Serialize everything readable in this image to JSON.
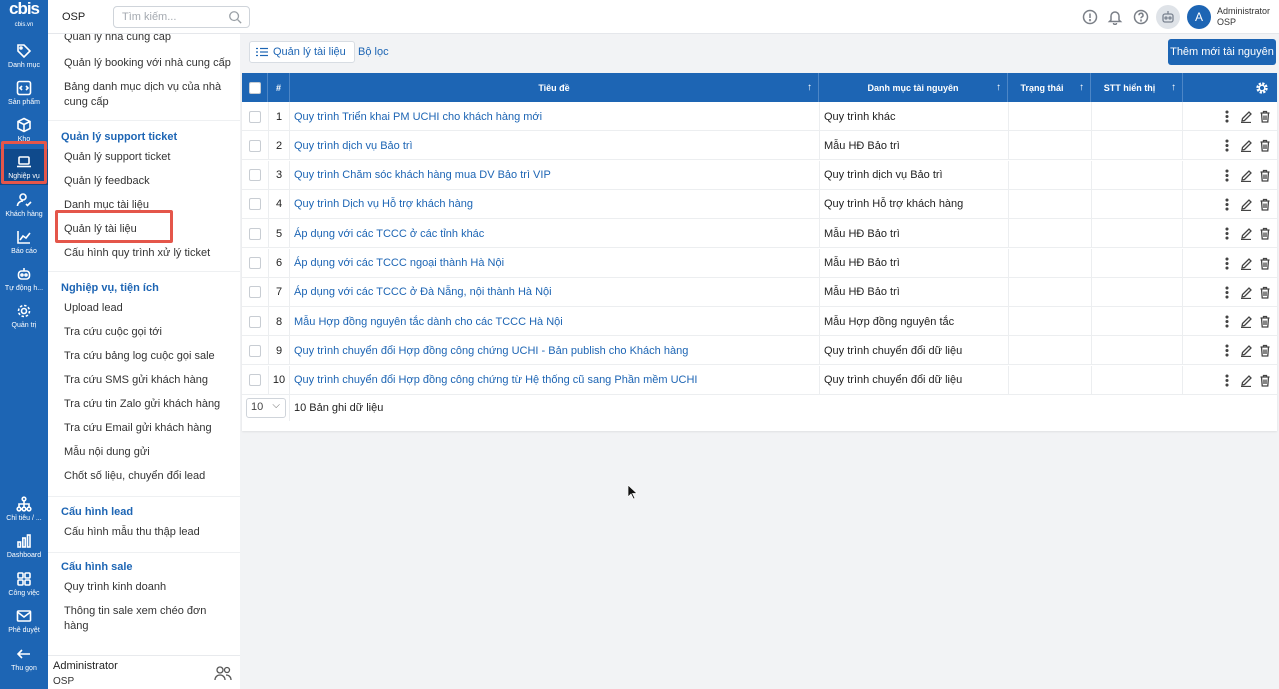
{
  "rail": {
    "logo": "cbis",
    "logo_sub": "cbis.vn",
    "items": [
      {
        "label": "Danh mục",
        "icon": "tag-icon"
      },
      {
        "label": "Sản phẩm",
        "icon": "code-icon"
      },
      {
        "label": "Kho",
        "icon": "box-icon"
      },
      {
        "label": "Nghiệp vụ",
        "icon": "laptop-icon"
      },
      {
        "label": "Khách hàng",
        "icon": "user-check-icon"
      },
      {
        "label": "Báo cáo",
        "icon": "line-chart-icon"
      },
      {
        "label": "Tự động h...",
        "icon": "robot-icon"
      },
      {
        "label": "Quản trị",
        "icon": "gear-icon"
      },
      {
        "label": "Chỉ tiêu / ...",
        "icon": "hierarchy-icon"
      },
      {
        "label": "Dashboard",
        "icon": "bar-chart-icon"
      },
      {
        "label": "Công việc",
        "icon": "grid-icon"
      },
      {
        "label": "Phê duyệt",
        "icon": "mail-check-icon"
      },
      {
        "label": "Thu gọn",
        "icon": "arrow-left-icon"
      }
    ]
  },
  "topbar": {
    "org": "OSP",
    "search_placeholder": "Tìm kiếm...",
    "user_initial": "A",
    "user_name": "Administrator",
    "user_org": "OSP"
  },
  "sidebar": {
    "items_top": [
      "Quản lý nhà cung cấp",
      "Quản lý booking với nhà cung cấp",
      "Bảng danh mục dịch vụ của nhà cung cấp"
    ],
    "section_support": "Quản lý support ticket",
    "items_support": [
      "Quản lý support ticket",
      "Quản lý feedback",
      "Danh mục tài liệu",
      "Quản lý tài liệu",
      "Cấu hình quy trình xử lý ticket"
    ],
    "section_util": "Nghiệp vụ, tiện ích",
    "items_util": [
      "Upload lead",
      "Tra cứu cuộc gọi tới",
      "Tra cứu bảng log cuộc gọi sale",
      "Tra cứu SMS gửi khách hàng",
      "Tra cứu tin Zalo gửi khách hàng",
      "Tra cứu Email gửi khách hàng",
      "Mẫu nội dung gửi",
      "Chốt số liệu, chuyển đổi lead"
    ],
    "section_lead": "Cấu hình lead",
    "items_lead": [
      "Cấu hình mẫu thu thập lead"
    ],
    "section_sale": "Cấu hình sale",
    "items_sale": [
      "Quy trình kinh doanh",
      "Thông tin sale xem chéo đơn hàng"
    ],
    "footer_name": "Administrator",
    "footer_org": "OSP"
  },
  "main": {
    "tab_docs": "Quản lý tài liệu",
    "tab_filter": "Bộ lọc",
    "add_button": "Thêm mới tài nguyên"
  },
  "table": {
    "headers": {
      "num": "#",
      "title": "Tiêu đề",
      "category": "Danh mục tài nguyên",
      "status": "Trạng thái",
      "order": "STT hiển thị"
    },
    "rows": [
      {
        "num": "1",
        "title": "Quy trình Triển khai PM UCHI cho khách hàng mới",
        "category": "Quy trình khác"
      },
      {
        "num": "2",
        "title": "Quy trình dịch vụ Bảo trì",
        "category": "Mẫu HĐ Bảo trì"
      },
      {
        "num": "3",
        "title": "Quy trình Chăm sóc khách hàng mua DV Bảo trì VIP",
        "category": "Quy trình dịch vụ Bảo trì"
      },
      {
        "num": "4",
        "title": "Quy trình Dịch vụ Hỗ trợ khách hàng",
        "category": "Quy trình Hỗ trợ khách hàng"
      },
      {
        "num": "5",
        "title": "Áp dụng với các TCCC ở các tỉnh khác",
        "category": "Mẫu HĐ Bảo trì"
      },
      {
        "num": "6",
        "title": "Áp dụng với các TCCC ngoại thành Hà Nội",
        "category": "Mẫu HĐ Bảo trì"
      },
      {
        "num": "7",
        "title": "Áp dụng với các TCCC ở Đà Nẵng, nội thành Hà Nội",
        "category": "Mẫu HĐ Bảo trì"
      },
      {
        "num": "8",
        "title": "Mẫu Hợp đồng nguyên tắc dành cho các TCCC Hà Nội",
        "category": "Mẫu Hợp đồng nguyên tắc"
      },
      {
        "num": "9",
        "title": "Quy trình chuyển đổi Hợp đồng công chứng UCHI - Bản publish cho Khách hàng",
        "category": "Quy trình chuyển đổi dữ liệu"
      },
      {
        "num": "10",
        "title": "Quy trình chuyển đổi Hợp đồng công chứng từ Hệ thống cũ sang Phần mềm UCHI",
        "category": "Quy trình chuyển đổi dữ liệu"
      }
    ],
    "page_size": "10",
    "record_count": "10 Bản ghi dữ liệu"
  },
  "colors": {
    "primary": "#1d65b4",
    "highlight": "#e4564a"
  }
}
